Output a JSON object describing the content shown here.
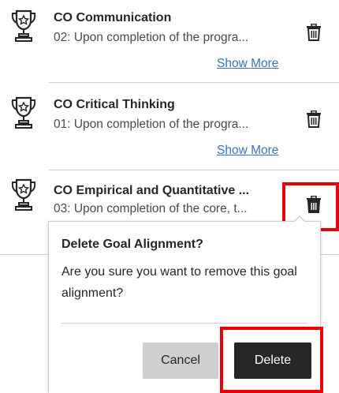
{
  "goals": [
    {
      "title": "CO Communication",
      "description": "02: Upon completion of the progra...",
      "show_more": "Show More"
    },
    {
      "title": "CO Critical Thinking",
      "description": "01: Upon completion of the progra...",
      "show_more": "Show More"
    },
    {
      "title": "CO Empirical and Quantitative ...",
      "description": "03: Upon completion of the core, t..."
    }
  ],
  "dialog": {
    "title": "Delete Goal Alignment?",
    "message": "Are you sure you want to remove this goal alignment?",
    "cancel_label": "Cancel",
    "delete_label": "Delete"
  },
  "icons": {
    "goal": "trophy-icon",
    "remove": "trash-icon"
  },
  "colors": {
    "link": "#3b73b9",
    "highlight": "#e8000b",
    "delete_button": "#262626",
    "cancel_button": "#cfcfcf"
  }
}
